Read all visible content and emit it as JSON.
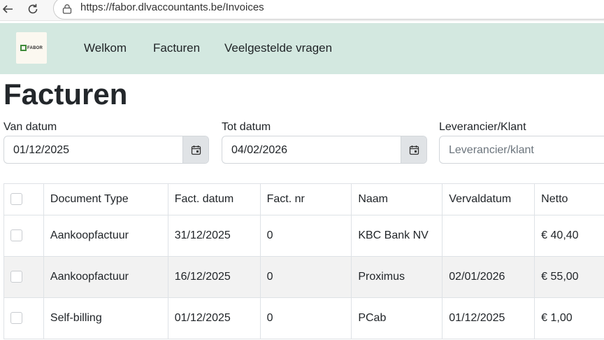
{
  "browser": {
    "url": "https://fabor.dlvaccountants.be/Invoices"
  },
  "nav": {
    "logo_text": "FABOR",
    "links": [
      "Welkom",
      "Facturen",
      "Veelgestelde vragen"
    ]
  },
  "page": {
    "title": "Facturen"
  },
  "filters": {
    "from": {
      "label": "Van datum",
      "value": "01/12/2025"
    },
    "to": {
      "label": "Tot datum",
      "value": "04/02/2026"
    },
    "supplier": {
      "label": "Leverancier/Klant",
      "placeholder": "Leverancier/klant"
    }
  },
  "table": {
    "headers": [
      "Document Type",
      "Fact. datum",
      "Fact. nr",
      "Naam",
      "Vervaldatum",
      "Netto"
    ],
    "rows": [
      [
        "Aankoopfactuur",
        "31/12/2025",
        "0",
        "KBC Bank NV",
        "",
        "€ 40,40"
      ],
      [
        "Aankoopfactuur",
        "16/12/2025",
        "0",
        "Proximus",
        "02/01/2026",
        "€ 55,00"
      ],
      [
        "Self-billing",
        "01/12/2025",
        "0",
        "PCab",
        "01/12/2025",
        "€ 1,00"
      ]
    ]
  },
  "colors": {
    "navbar": "#d3e8e0",
    "stripe": "#f2f2f2",
    "logo_green": "#3f8a3a"
  }
}
